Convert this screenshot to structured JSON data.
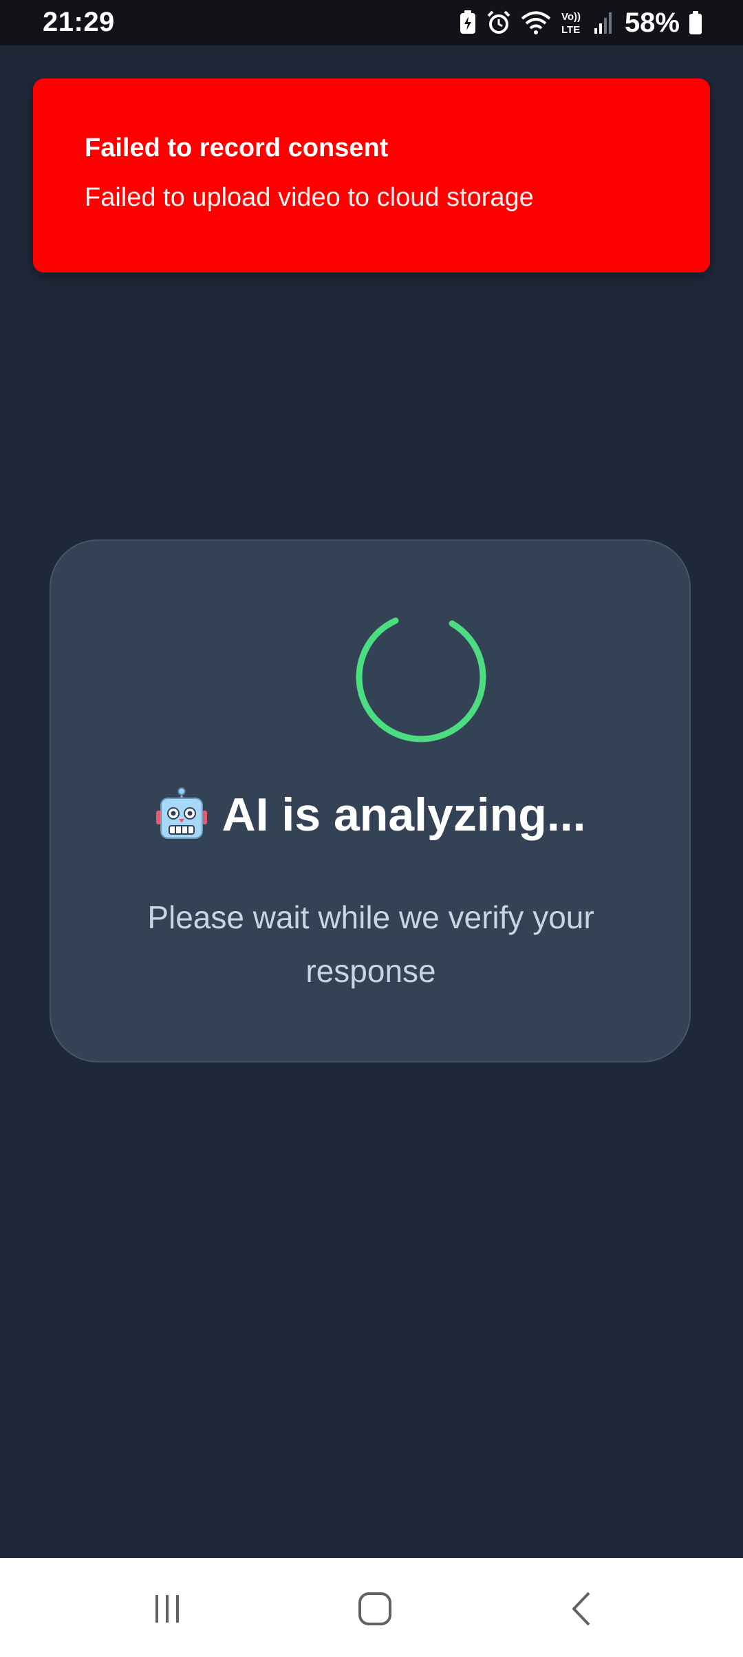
{
  "status_bar": {
    "time": "21:29",
    "battery_percent": "58%",
    "network_label_top": "Vo))",
    "network_label_bottom": "LTE",
    "icons": [
      "battery-saver-icon",
      "alarm-icon",
      "wifi-icon",
      "volte-icon",
      "signal-icon",
      "battery-icon"
    ]
  },
  "toast": {
    "title": "Failed to record consent",
    "message": "Failed to upload video to cloud storage",
    "background_color": "#ff0000"
  },
  "analysis_card": {
    "heading": "AI is analyzing...",
    "heading_icon": "robot-icon",
    "subtext": "Please wait while we verify your response",
    "spinner_color": "#4ade80"
  },
  "nav_bar": {
    "buttons": [
      "recent-apps-button",
      "home-button",
      "back-button"
    ]
  }
}
